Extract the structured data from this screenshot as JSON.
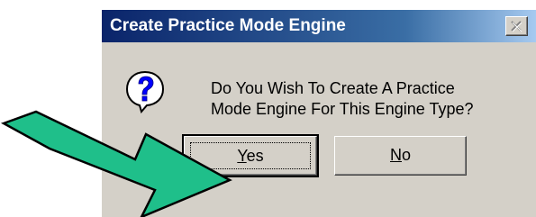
{
  "dialog": {
    "title": "Create Practice Mode Engine",
    "message_line1": "Do You Wish To Create A Practice",
    "message_line2": "Mode Engine For This Engine Type?",
    "icon": "question-icon",
    "close_icon": "close-icon"
  },
  "buttons": {
    "yes_mnemonic": "Y",
    "yes_rest": "es",
    "no_mnemonic": "N",
    "no_rest": "o"
  },
  "annotation": {
    "arrow_icon": "arrow-right-icon",
    "arrow_color": "#1fbf8a"
  },
  "colors": {
    "title_start": "#0a246a",
    "title_end": "#a6caf0",
    "dialog_bg": "#d4d0c8"
  }
}
